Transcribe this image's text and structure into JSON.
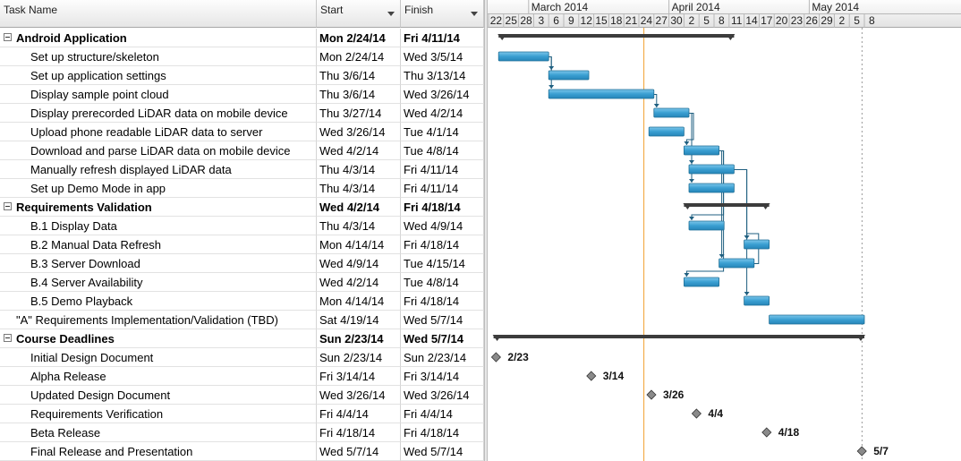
{
  "columns": {
    "task_name": "Task Name",
    "start": "Start",
    "finish": "Finish"
  },
  "timescale": {
    "months": [
      {
        "label": "March 2014",
        "start": "2014-03-02"
      },
      {
        "label": "April 2014",
        "start": "2014-03-30"
      },
      {
        "label": "May 2014",
        "start": "2014-04-27"
      }
    ],
    "days": [
      "22",
      "25",
      "28",
      "3",
      "6",
      "9",
      "12",
      "15",
      "18",
      "21",
      "24",
      "27",
      "30",
      "2",
      "5",
      "8",
      "11",
      "14",
      "17",
      "20",
      "23",
      "26",
      "29",
      "2",
      "5",
      "8"
    ],
    "first_day": "2014-02-22",
    "day_step": 3,
    "current_date": "2014-03-25"
  },
  "tasks": [
    {
      "name": "Android Application",
      "start": "Mon 2/24/14",
      "finish": "Fri 4/11/14",
      "level": 0,
      "summary": true,
      "type": "summary",
      "s": "2014-02-24",
      "f": "2014-04-11"
    },
    {
      "name": "Set up structure/skeleton",
      "start": "Mon 2/24/14",
      "finish": "Wed 3/5/14",
      "level": 1,
      "type": "task",
      "s": "2014-02-24",
      "f": "2014-03-05"
    },
    {
      "name": "Set up application settings",
      "start": "Thu 3/6/14",
      "finish": "Thu 3/13/14",
      "level": 1,
      "type": "task",
      "s": "2014-03-06",
      "f": "2014-03-13"
    },
    {
      "name": "Display sample point cloud",
      "start": "Thu 3/6/14",
      "finish": "Wed 3/26/14",
      "level": 1,
      "type": "task",
      "s": "2014-03-06",
      "f": "2014-03-26"
    },
    {
      "name": "Display prerecorded LiDAR data on mobile device",
      "start": "Thu 3/27/14",
      "finish": "Wed 4/2/14",
      "level": 1,
      "type": "task",
      "s": "2014-03-27",
      "f": "2014-04-02"
    },
    {
      "name": "Upload phone readable LiDAR data to server",
      "start": "Wed 3/26/14",
      "finish": "Tue 4/1/14",
      "level": 1,
      "type": "task",
      "s": "2014-03-26",
      "f": "2014-04-01"
    },
    {
      "name": "Download and parse LiDAR data on mobile device",
      "start": "Wed 4/2/14",
      "finish": "Tue 4/8/14",
      "level": 1,
      "type": "task",
      "s": "2014-04-02",
      "f": "2014-04-08"
    },
    {
      "name": "Manually refresh displayed LiDAR data",
      "start": "Thu 4/3/14",
      "finish": "Fri 4/11/14",
      "level": 1,
      "type": "task",
      "s": "2014-04-03",
      "f": "2014-04-11"
    },
    {
      "name": "Set up Demo Mode in app",
      "start": "Thu 4/3/14",
      "finish": "Fri 4/11/14",
      "level": 1,
      "type": "task",
      "s": "2014-04-03",
      "f": "2014-04-11"
    },
    {
      "name": "Requirements Validation",
      "start": "Wed 4/2/14",
      "finish": "Fri 4/18/14",
      "level": 0,
      "summary": true,
      "type": "summary",
      "s": "2014-04-02",
      "f": "2014-04-18"
    },
    {
      "name": "B.1 Display Data",
      "start": "Thu 4/3/14",
      "finish": "Wed 4/9/14",
      "level": 1,
      "type": "task",
      "s": "2014-04-03",
      "f": "2014-04-09"
    },
    {
      "name": "B.2 Manual Data Refresh",
      "start": "Mon 4/14/14",
      "finish": "Fri 4/18/14",
      "level": 1,
      "type": "task",
      "s": "2014-04-14",
      "f": "2014-04-18"
    },
    {
      "name": "B.3 Server Download",
      "start": "Wed 4/9/14",
      "finish": "Tue 4/15/14",
      "level": 1,
      "type": "task",
      "s": "2014-04-09",
      "f": "2014-04-15"
    },
    {
      "name": "B.4 Server Availability",
      "start": "Wed 4/2/14",
      "finish": "Tue 4/8/14",
      "level": 1,
      "type": "task",
      "s": "2014-04-02",
      "f": "2014-04-08"
    },
    {
      "name": "B.5 Demo Playback",
      "start": "Mon 4/14/14",
      "finish": "Fri 4/18/14",
      "level": 1,
      "type": "task",
      "s": "2014-04-14",
      "f": "2014-04-18"
    },
    {
      "name": "\"A\" Requirements Implementation/Validation (TBD)",
      "start": "Sat 4/19/14",
      "finish": "Wed 5/7/14",
      "level": 0,
      "summary": false,
      "type": "task",
      "s": "2014-04-19",
      "f": "2014-05-07"
    },
    {
      "name": "Course Deadlines",
      "start": "Sun 2/23/14",
      "finish": "Wed 5/7/14",
      "level": 0,
      "summary": true,
      "type": "summary",
      "s": "2014-02-23",
      "f": "2014-05-07"
    },
    {
      "name": "Initial Design Document",
      "start": "Sun 2/23/14",
      "finish": "Sun 2/23/14",
      "level": 1,
      "type": "milestone",
      "s": "2014-02-23",
      "label": "2/23"
    },
    {
      "name": "Alpha Release",
      "start": "Fri 3/14/14",
      "finish": "Fri 3/14/14",
      "level": 1,
      "type": "milestone",
      "s": "2014-03-14",
      "label": "3/14"
    },
    {
      "name": "Updated Design Document",
      "start": "Wed 3/26/14",
      "finish": "Wed 3/26/14",
      "level": 1,
      "type": "milestone",
      "s": "2014-03-26",
      "label": "3/26"
    },
    {
      "name": "Requirements Verification",
      "start": "Fri 4/4/14",
      "finish": "Fri 4/4/14",
      "level": 1,
      "type": "milestone",
      "s": "2014-04-04",
      "label": "4/4"
    },
    {
      "name": "Beta Release",
      "start": "Fri 4/18/14",
      "finish": "Fri 4/18/14",
      "level": 1,
      "type": "milestone",
      "s": "2014-04-18",
      "label": "4/18"
    },
    {
      "name": "Final Release and Presentation",
      "start": "Wed 5/7/14",
      "finish": "Wed 5/7/14",
      "level": 1,
      "type": "milestone",
      "s": "2014-05-07",
      "label": "5/7"
    }
  ],
  "links": [
    [
      1,
      2
    ],
    [
      1,
      3
    ],
    [
      3,
      4
    ],
    [
      4,
      6
    ],
    [
      4,
      7
    ],
    [
      4,
      8
    ],
    [
      6,
      10
    ],
    [
      6,
      12
    ],
    [
      6,
      13
    ],
    [
      7,
      11
    ],
    [
      7,
      14
    ],
    [
      12,
      11
    ]
  ],
  "colors": {
    "bar": "#3a9fd2",
    "bar_border": "#1f6f96",
    "summary": "#3c3c3c",
    "link": "#1f5f80",
    "today": "#f0a030",
    "grid": "#d4d4d4",
    "header": "#e6e6e6"
  }
}
